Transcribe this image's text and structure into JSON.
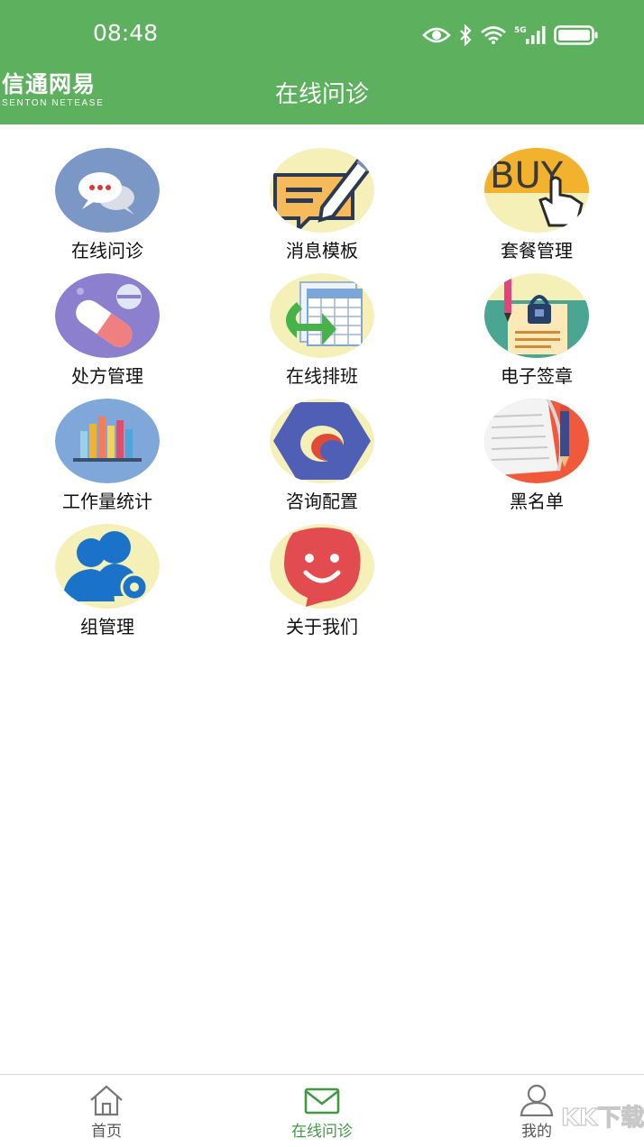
{
  "status_bar": {
    "time": "08:48"
  },
  "header": {
    "logo_cn": "信通网易",
    "logo_en": "SENTON NETEASE",
    "title": "在线问诊"
  },
  "grid": {
    "items": [
      {
        "label": "在线问诊",
        "icon": "chat-bubbles-icon"
      },
      {
        "label": "消息模板",
        "icon": "message-template-icon"
      },
      {
        "label": "套餐管理",
        "icon": "buy-icon"
      },
      {
        "label": "处方管理",
        "icon": "pill-icon"
      },
      {
        "label": "在线排班",
        "icon": "schedule-icon"
      },
      {
        "label": "电子签章",
        "icon": "stamp-icon"
      },
      {
        "label": "工作量统计",
        "icon": "bar-stats-icon"
      },
      {
        "label": "咨询配置",
        "icon": "config-icon"
      },
      {
        "label": "黑名单",
        "icon": "blacklist-icon"
      },
      {
        "label": "组管理",
        "icon": "group-icon"
      },
      {
        "label": "关于我们",
        "icon": "smile-icon"
      }
    ]
  },
  "bottom_nav": {
    "home": "首页",
    "consult": "在线问诊",
    "mine": "我的"
  },
  "watermark": {
    "text": "KK下载"
  },
  "colors": {
    "brand_green": "#5db05e",
    "active_nav": "#3f9a43"
  }
}
